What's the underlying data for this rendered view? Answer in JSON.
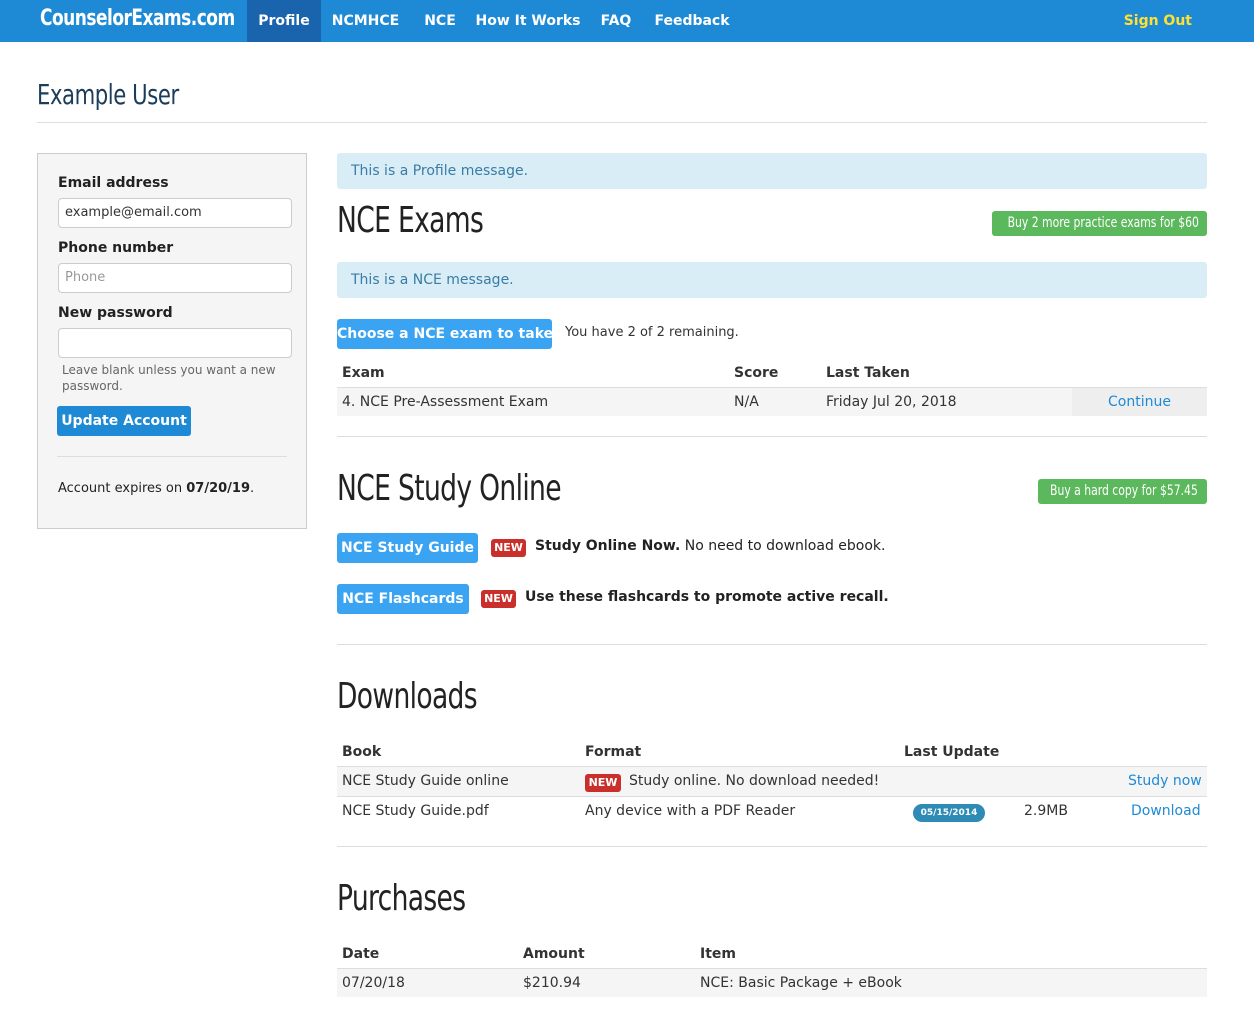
{
  "nav": {
    "brand": "CounselorExams.com",
    "items": [
      "Profile",
      "NCMHCE",
      "NCE",
      "How It Works",
      "FAQ",
      "Feedback"
    ],
    "sign_out": "Sign Out"
  },
  "page_title": "Example User",
  "account": {
    "email_label": "Email address",
    "email_value": "example@email.com",
    "phone_label": "Phone number",
    "phone_placeholder": "Phone",
    "password_label": "New password",
    "password_help": "Leave blank unless you want a new password.",
    "update_button": "Update Account",
    "expires_prefix": "Account expires on",
    "expires_date": "07/20/19",
    "expires_suffix": "."
  },
  "messages": {
    "profile": "This is a Profile message.",
    "nce": "This is a NCE message."
  },
  "exams": {
    "title": "NCE Exams",
    "buy_button": "Buy 2 more practice exams for $60",
    "choose_button": "Choose a NCE exam to take",
    "remaining": "You have 2 of 2 remaining.",
    "headers": [
      "Exam",
      "Score",
      "Last Taken"
    ],
    "rows": [
      {
        "exam": "4. NCE Pre-Assessment Exam",
        "score": "N/A",
        "last_taken": "Friday Jul 20, 2018",
        "action": "Continue"
      }
    ]
  },
  "study": {
    "title": "NCE Study Online",
    "buy_button": "Buy a hard copy for $57.45",
    "items": [
      {
        "button": "NCE Study Guide",
        "badge": "NEW",
        "bold": "Study Online Now.",
        "text": " No need to download ebook."
      },
      {
        "button": "NCE Flashcards",
        "badge": "NEW",
        "bold": "Use these flashcards to promote active recall.",
        "text": ""
      }
    ]
  },
  "downloads": {
    "title": "Downloads",
    "headers": [
      "Book",
      "Format",
      "Last Update"
    ],
    "rows": [
      {
        "book": "NCE Study Guide online",
        "badge": "NEW",
        "format": "Study online. No download needed!",
        "date": "",
        "size": "",
        "action": "Study now"
      },
      {
        "book": "NCE Study Guide.pdf",
        "badge": "",
        "format": "Any device with a PDF Reader",
        "date": "05/15/2014",
        "size": "2.9MB",
        "action": "Download"
      }
    ]
  },
  "purchases": {
    "title": "Purchases",
    "headers": [
      "Date",
      "Amount",
      "Item"
    ],
    "rows": [
      {
        "date": "07/20/18",
        "amount": "$210.94",
        "item": "NCE: Basic Package + eBook"
      }
    ]
  },
  "colors": {
    "nav_bg": "#1e8ad6",
    "nav_active": "#1a63ad",
    "sign_out": "#ffe033",
    "alert_bg": "#d9edf7",
    "green_button": "#5cb85c",
    "new_badge": "#c9302c"
  }
}
